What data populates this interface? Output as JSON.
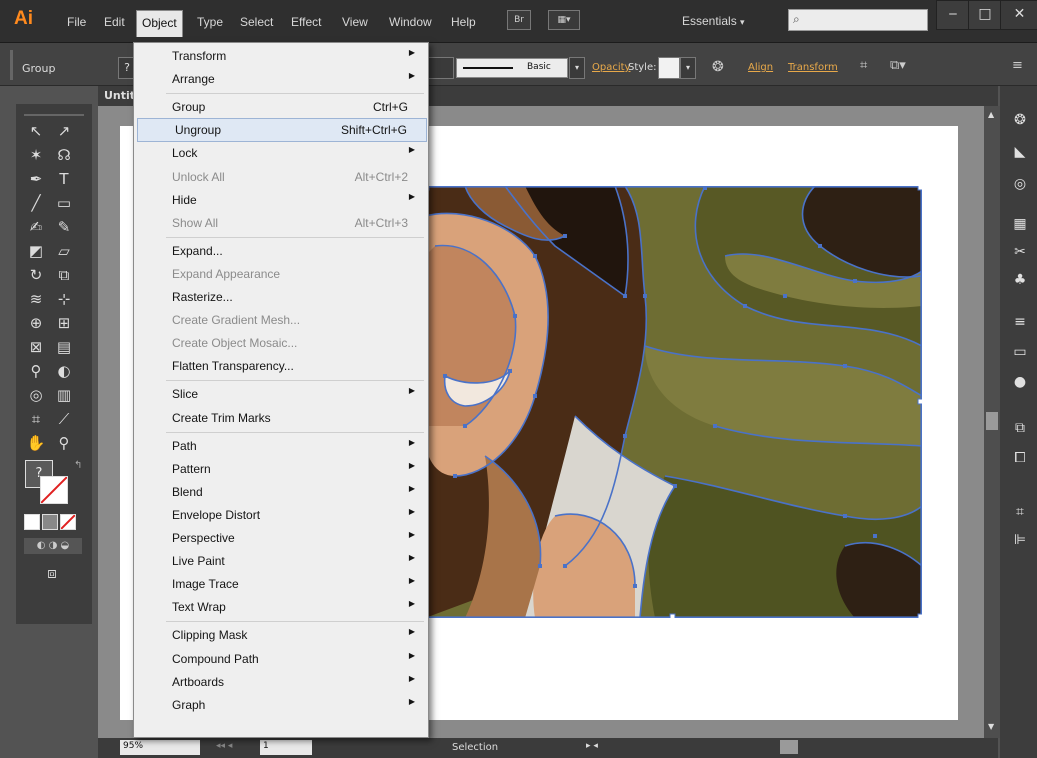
{
  "app": {
    "logo": "Ai"
  },
  "menubar": {
    "items": [
      "File",
      "Edit",
      "Object",
      "Type",
      "Select",
      "Effect",
      "View",
      "Window",
      "Help"
    ],
    "active": "Object",
    "bridge_button": "Br",
    "workspace": "Essentials",
    "search_placeholder": ""
  },
  "controlbar": {
    "selection_label": "Group",
    "stroke_profile": "Basic",
    "opacity_link": "Opacity",
    "style_label": "Style:",
    "align_link": "Align",
    "transform_link": "Transform"
  },
  "document": {
    "tab_label": "Untitl"
  },
  "statusbar": {
    "zoom": "95%",
    "page": "1",
    "status": "Selection"
  },
  "object_menu": [
    {
      "type": "item",
      "label": "Transform",
      "submenu": true
    },
    {
      "type": "item",
      "label": "Arrange",
      "submenu": true
    },
    {
      "type": "separator"
    },
    {
      "type": "item",
      "label": "Group",
      "shortcut": "Ctrl+G"
    },
    {
      "type": "item",
      "label": "Ungroup",
      "shortcut": "Shift+Ctrl+G",
      "highlighted": true
    },
    {
      "type": "item",
      "label": "Lock",
      "submenu": true
    },
    {
      "type": "item",
      "label": "Unlock All",
      "shortcut": "Alt+Ctrl+2",
      "disabled": true
    },
    {
      "type": "item",
      "label": "Hide",
      "submenu": true
    },
    {
      "type": "item",
      "label": "Show All",
      "shortcut": "Alt+Ctrl+3",
      "disabled": true
    },
    {
      "type": "separator"
    },
    {
      "type": "item",
      "label": "Expand..."
    },
    {
      "type": "item",
      "label": "Expand Appearance",
      "disabled": true
    },
    {
      "type": "item",
      "label": "Rasterize..."
    },
    {
      "type": "item",
      "label": "Create Gradient Mesh...",
      "disabled": true
    },
    {
      "type": "item",
      "label": "Create Object Mosaic...",
      "disabled": true
    },
    {
      "type": "item",
      "label": "Flatten Transparency..."
    },
    {
      "type": "separator"
    },
    {
      "type": "item",
      "label": "Slice",
      "submenu": true
    },
    {
      "type": "item",
      "label": "Create Trim Marks"
    },
    {
      "type": "separator"
    },
    {
      "type": "item",
      "label": "Path",
      "submenu": true
    },
    {
      "type": "item",
      "label": "Pattern",
      "submenu": true
    },
    {
      "type": "item",
      "label": "Blend",
      "submenu": true
    },
    {
      "type": "item",
      "label": "Envelope Distort",
      "submenu": true
    },
    {
      "type": "item",
      "label": "Perspective",
      "submenu": true
    },
    {
      "type": "item",
      "label": "Live Paint",
      "submenu": true
    },
    {
      "type": "item",
      "label": "Image Trace",
      "submenu": true
    },
    {
      "type": "item",
      "label": "Text Wrap",
      "submenu": true
    },
    {
      "type": "separator"
    },
    {
      "type": "item",
      "label": "Clipping Mask",
      "submenu": true
    },
    {
      "type": "item",
      "label": "Compound Path",
      "submenu": true
    },
    {
      "type": "item",
      "label": "Artboards",
      "submenu": true
    },
    {
      "type": "item",
      "label": "Graph",
      "submenu": true
    }
  ],
  "colors": {
    "accent_orange": "#ff8a1e",
    "path_selection": "#4a72c8",
    "menu_highlight": "#dfe8f4"
  }
}
